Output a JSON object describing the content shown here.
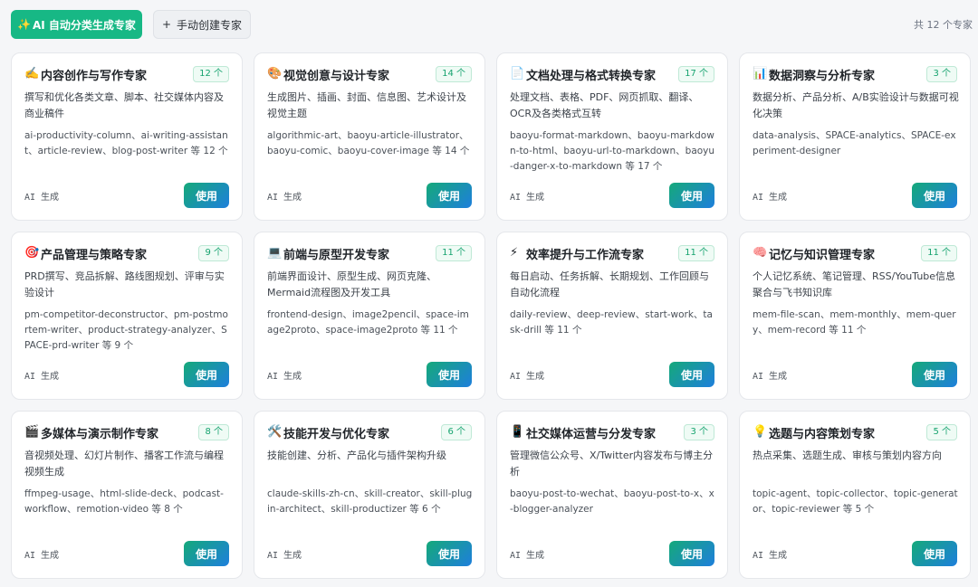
{
  "toolbar": {
    "ai_icon": "✨",
    "ai_label": "AI 自动分类生成专家",
    "manual_icon": "+",
    "manual_label": "手动创建专家",
    "total_label": "共 12 个专家"
  },
  "cards": [
    {
      "icon": "✍️",
      "title": "内容创作与写作专家",
      "badge": "12 个",
      "desc": "撰写和优化各类文章、脚本、社交媒体内容及商业稿件",
      "skills": "ai-productivity-column、ai-writing-assistant、article-review、blog-post-writer 等 12 个",
      "source": "AI 生成",
      "use_label": "使用"
    },
    {
      "icon": "🎨",
      "title": "视觉创意与设计专家",
      "badge": "14 个",
      "desc": "生成图片、插画、封面、信息图、艺术设计及视觉主题",
      "skills": "algorithmic-art、baoyu-article-illustrator、baoyu-comic、baoyu-cover-image 等 14 个",
      "source": "AI 生成",
      "use_label": "使用"
    },
    {
      "icon": "📄",
      "title": "文档处理与格式转换专家",
      "badge": "17 个",
      "desc": "处理文档、表格、PDF、网页抓取、翻译、OCR及各类格式互转",
      "skills": "baoyu-format-markdown、baoyu-markdown-to-html、baoyu-url-to-markdown、baoyu-danger-x-to-markdown 等 17 个",
      "source": "AI 生成",
      "use_label": "使用"
    },
    {
      "icon": "📊",
      "title": "数据洞察与分析专家",
      "badge": "3 个",
      "desc": "数据分析、产品分析、A/B实验设计与数据可视化决策",
      "skills": "data-analysis、SPACE-analytics、SPACE-experiment-designer",
      "source": "AI 生成",
      "use_label": "使用"
    },
    {
      "icon": "🎯",
      "title": "产品管理与策略专家",
      "badge": "9 个",
      "desc": "PRD撰写、竞品拆解、路线图规划、评审与实验设计",
      "skills": "pm-competitor-deconstructor、pm-postmortem-writer、product-strategy-analyzer、SPACE-prd-writer 等 9 个",
      "source": "AI 生成",
      "use_label": "使用"
    },
    {
      "icon": "💻",
      "title": "前端与原型开发专家",
      "badge": "11 个",
      "desc": "前端界面设计、原型生成、网页克隆、Mermaid流程图及开发工具",
      "skills": "frontend-design、image2pencil、space-image2proto、space-image2proto 等 11 个",
      "source": "AI 生成",
      "use_label": "使用"
    },
    {
      "icon": "⚡",
      "title": "效率提升与工作流专家",
      "badge": "11 个",
      "desc": "每日启动、任务拆解、长期规划、工作回顾与自动化流程",
      "skills": "daily-review、deep-review、start-work、task-drill 等 11 个",
      "source": "AI 生成",
      "use_label": "使用"
    },
    {
      "icon": "🧠",
      "title": "记忆与知识管理专家",
      "badge": "11 个",
      "desc": "个人记忆系统、笔记管理、RSS/YouTube信息聚合与飞书知识库",
      "skills": "mem-file-scan、mem-monthly、mem-query、mem-record 等 11 个",
      "source": "AI 生成",
      "use_label": "使用"
    },
    {
      "icon": "🎬",
      "title": "多媒体与演示制作专家",
      "badge": "8 个",
      "desc": "音视频处理、幻灯片制作、播客工作流与编程视频生成",
      "skills": "ffmpeg-usage、html-slide-deck、podcast-workflow、remotion-video 等 8 个",
      "source": "AI 生成",
      "use_label": "使用"
    },
    {
      "icon": "🛠️",
      "title": "技能开发与优化专家",
      "badge": "6 个",
      "desc": "技能创建、分析、产品化与插件架构升级",
      "skills": "claude-skills-zh-cn、skill-creator、skill-plugin-architect、skill-productizer 等 6 个",
      "source": "AI 生成",
      "use_label": "使用"
    },
    {
      "icon": "📱",
      "title": "社交媒体运营与分发专家",
      "badge": "3 个",
      "desc": "管理微信公众号、X/Twitter内容发布与博主分析",
      "skills": "baoyu-post-to-wechat、baoyu-post-to-x、x-blogger-analyzer",
      "source": "AI 生成",
      "use_label": "使用"
    },
    {
      "icon": "💡",
      "title": "选题与内容策划专家",
      "badge": "5 个",
      "desc": "热点采集、选题生成、审核与策划内容方向",
      "skills": "topic-agent、topic-collector、topic-generator、topic-reviewer 等 5 个",
      "source": "AI 生成",
      "use_label": "使用"
    }
  ]
}
